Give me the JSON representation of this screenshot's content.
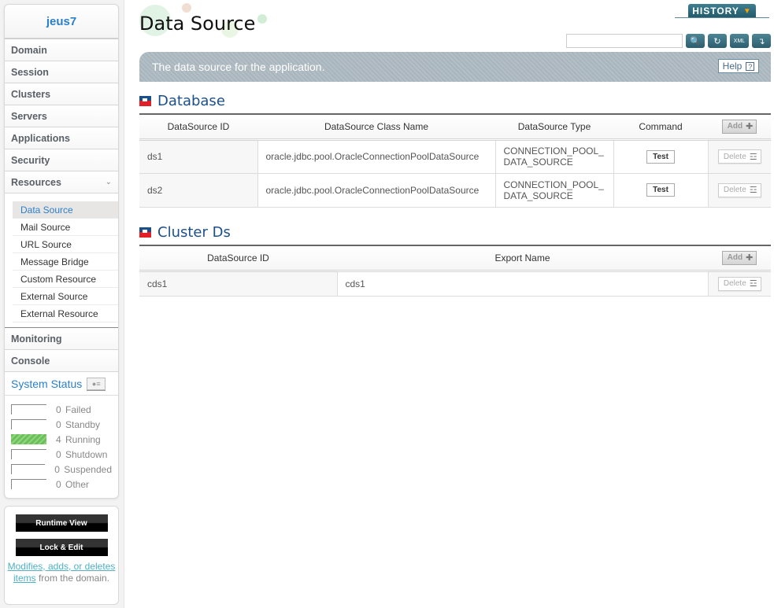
{
  "sidebar": {
    "domain_name": "jeus7",
    "nav": [
      {
        "label": "Domain"
      },
      {
        "label": "Session"
      },
      {
        "label": "Clusters"
      },
      {
        "label": "Servers"
      },
      {
        "label": "Applications"
      },
      {
        "label": "Security"
      },
      {
        "label": "Resources",
        "expanded": true
      }
    ],
    "resources_sub": [
      {
        "label": "Data Source",
        "active": true
      },
      {
        "label": "Mail Source"
      },
      {
        "label": "URL Source"
      },
      {
        "label": "Message Bridge"
      },
      {
        "label": "Custom Resource"
      },
      {
        "label": "External Source"
      },
      {
        "label": "External Resource"
      }
    ],
    "nav_bottom": [
      {
        "label": "Monitoring"
      },
      {
        "label": "Console"
      }
    ],
    "system_status": {
      "title": "System Status",
      "items": [
        {
          "count": "0",
          "label": "Failed"
        },
        {
          "count": "0",
          "label": "Standby"
        },
        {
          "count": "4",
          "label": "Running"
        },
        {
          "count": "0",
          "label": "Shutdown"
        },
        {
          "count": "0",
          "label": "Suspended"
        },
        {
          "count": "0",
          "label": "Other"
        }
      ]
    },
    "commands": {
      "runtime_view": "Runtime View",
      "lock_edit": "Lock & Edit",
      "note_link": "Modifies, adds, or deletes items",
      "note_rest": " from the domain."
    }
  },
  "header": {
    "title": "Data Source",
    "history_label": "HISTORY",
    "search_value": "",
    "description": "The data source for the application.",
    "help_label": "Help",
    "help_icon": "?"
  },
  "database": {
    "title": "Database",
    "columns": [
      "DataSource ID",
      "DataSource Class Name",
      "DataSource Type",
      "Command"
    ],
    "add_label": "Add",
    "rows": [
      {
        "id": "ds1",
        "class_name": "oracle.jdbc.pool.OracleConnectionPoolDataSource",
        "type_line1": "CONNECTION_POOL_",
        "type_line2": "DATA_SOURCE",
        "command": "Test",
        "delete": "Delete"
      },
      {
        "id": "ds2",
        "class_name": "oracle.jdbc.pool.OracleConnectionPoolDataSource",
        "type_line1": "CONNECTION_POOL_",
        "type_line2": "DATA_SOURCE",
        "command": "Test",
        "delete": "Delete"
      }
    ]
  },
  "cluster_ds": {
    "title": "Cluster Ds",
    "columns": [
      "DataSource ID",
      "Export Name"
    ],
    "add_label": "Add",
    "rows": [
      {
        "id": "cds1",
        "export_name": "cds1",
        "delete": "Delete"
      }
    ]
  },
  "colors": {
    "accent_blue": "#2a7fc9",
    "section_blue": "#1b4f8a",
    "running_green": "#6cbf5a",
    "history_teal": "#2c5f70"
  }
}
